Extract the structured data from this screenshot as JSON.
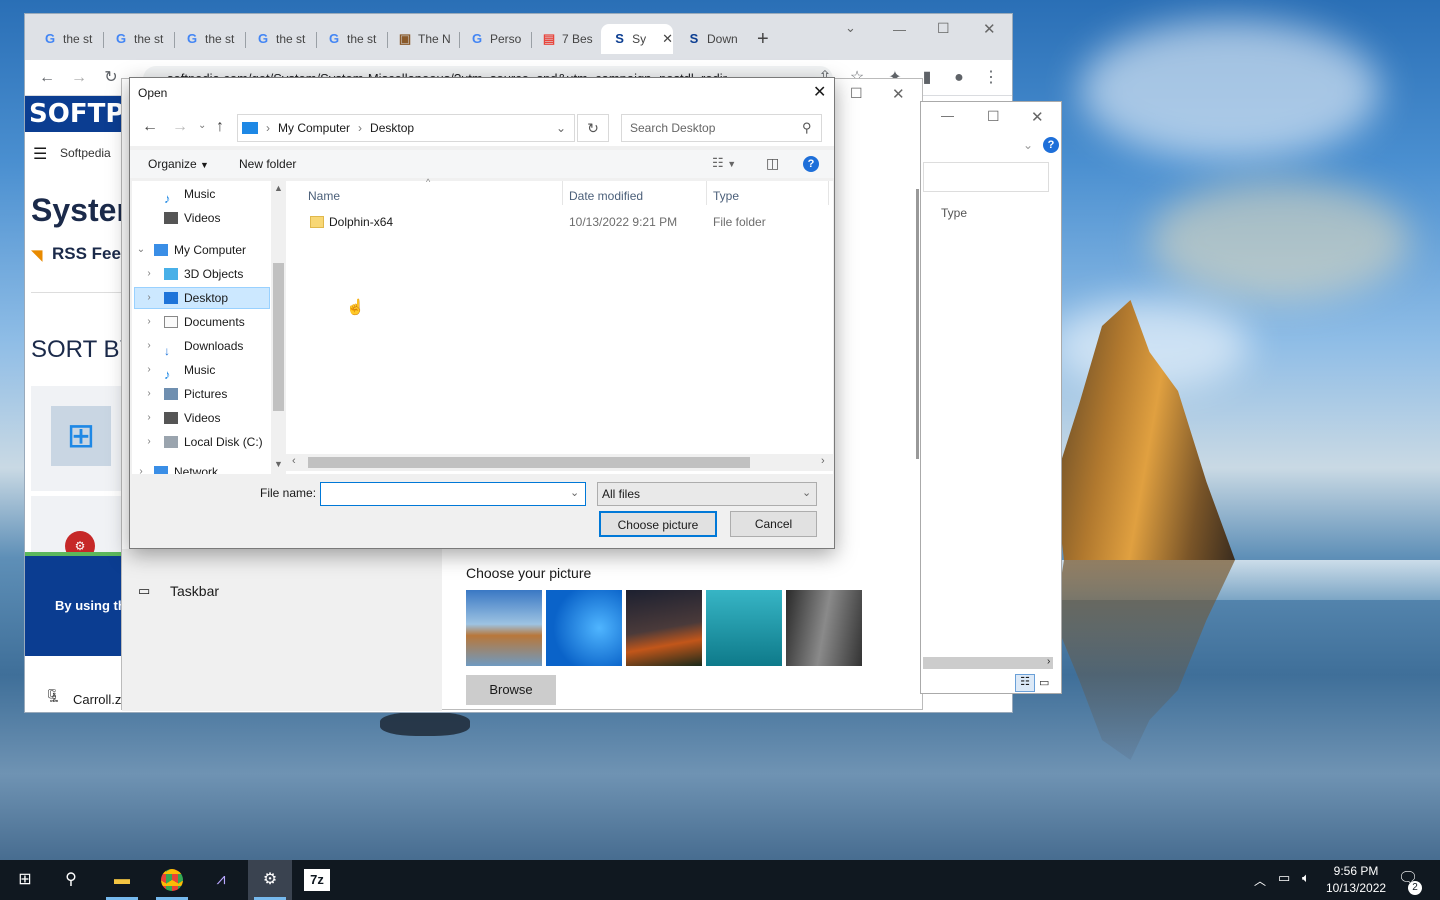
{
  "browser": {
    "tabs": [
      {
        "label": "the st"
      },
      {
        "label": "the st"
      },
      {
        "label": "the st"
      },
      {
        "label": "the st"
      },
      {
        "label": "the st"
      },
      {
        "label": "The N"
      },
      {
        "label": "Perso"
      },
      {
        "label": "7 Bes"
      },
      {
        "label": "Sy"
      },
      {
        "label": "Down"
      }
    ],
    "url": "softpedia.com/get/System/System-Miscellaneous/?utm_source=spd&utm_campaign=postdl_redir",
    "page": {
      "logo": "SOFTPE",
      "menu_label": "Softpedia",
      "heading": "Syster",
      "rss": "RSS Feed",
      "sort_by": "SORT BY:",
      "banner": "By using the",
      "download_item": "Carroll.zi"
    }
  },
  "settings": {
    "taskbar_label": "Taskbar",
    "choose_picture_heading": "Choose your picture",
    "browse_label": "Browse"
  },
  "explorer_behind": {
    "col_type": "Type"
  },
  "dialog": {
    "title": "Open",
    "breadcrumb": [
      "My Computer",
      "Desktop"
    ],
    "search_placeholder": "Search Desktop",
    "organize_label": "Organize",
    "new_folder_label": "New folder",
    "tree": [
      {
        "label": "Music",
        "icon": "music-icon",
        "indent": 1
      },
      {
        "label": "Videos",
        "icon": "video-icon",
        "indent": 1
      },
      {
        "label": "My Computer",
        "icon": "computer-icon",
        "indent": 0
      },
      {
        "label": "3D Objects",
        "icon": "cube-icon",
        "indent": 1
      },
      {
        "label": "Desktop",
        "icon": "desktop-icon",
        "indent": 1
      },
      {
        "label": "Documents",
        "icon": "document-icon",
        "indent": 1
      },
      {
        "label": "Downloads",
        "icon": "download-icon",
        "indent": 1
      },
      {
        "label": "Music",
        "icon": "music-icon",
        "indent": 1
      },
      {
        "label": "Pictures",
        "icon": "picture-icon",
        "indent": 1
      },
      {
        "label": "Videos",
        "icon": "video-icon",
        "indent": 1
      },
      {
        "label": "Local Disk (C:)",
        "icon": "disk-icon",
        "indent": 1
      },
      {
        "label": "Network",
        "icon": "network-icon",
        "indent": 0
      }
    ],
    "columns": {
      "name": "Name",
      "date": "Date modified",
      "type": "Type"
    },
    "files": [
      {
        "name": "Dolphin-x64",
        "date": "10/13/2022 9:21 PM",
        "type": "File folder"
      }
    ],
    "file_name_label": "File name:",
    "file_name_value": "",
    "filter_value": "All files",
    "choose_button": "Choose picture",
    "cancel_button": "Cancel"
  },
  "taskbar": {
    "time": "9:56 PM",
    "date": "10/13/2022",
    "notification_count": "2"
  }
}
